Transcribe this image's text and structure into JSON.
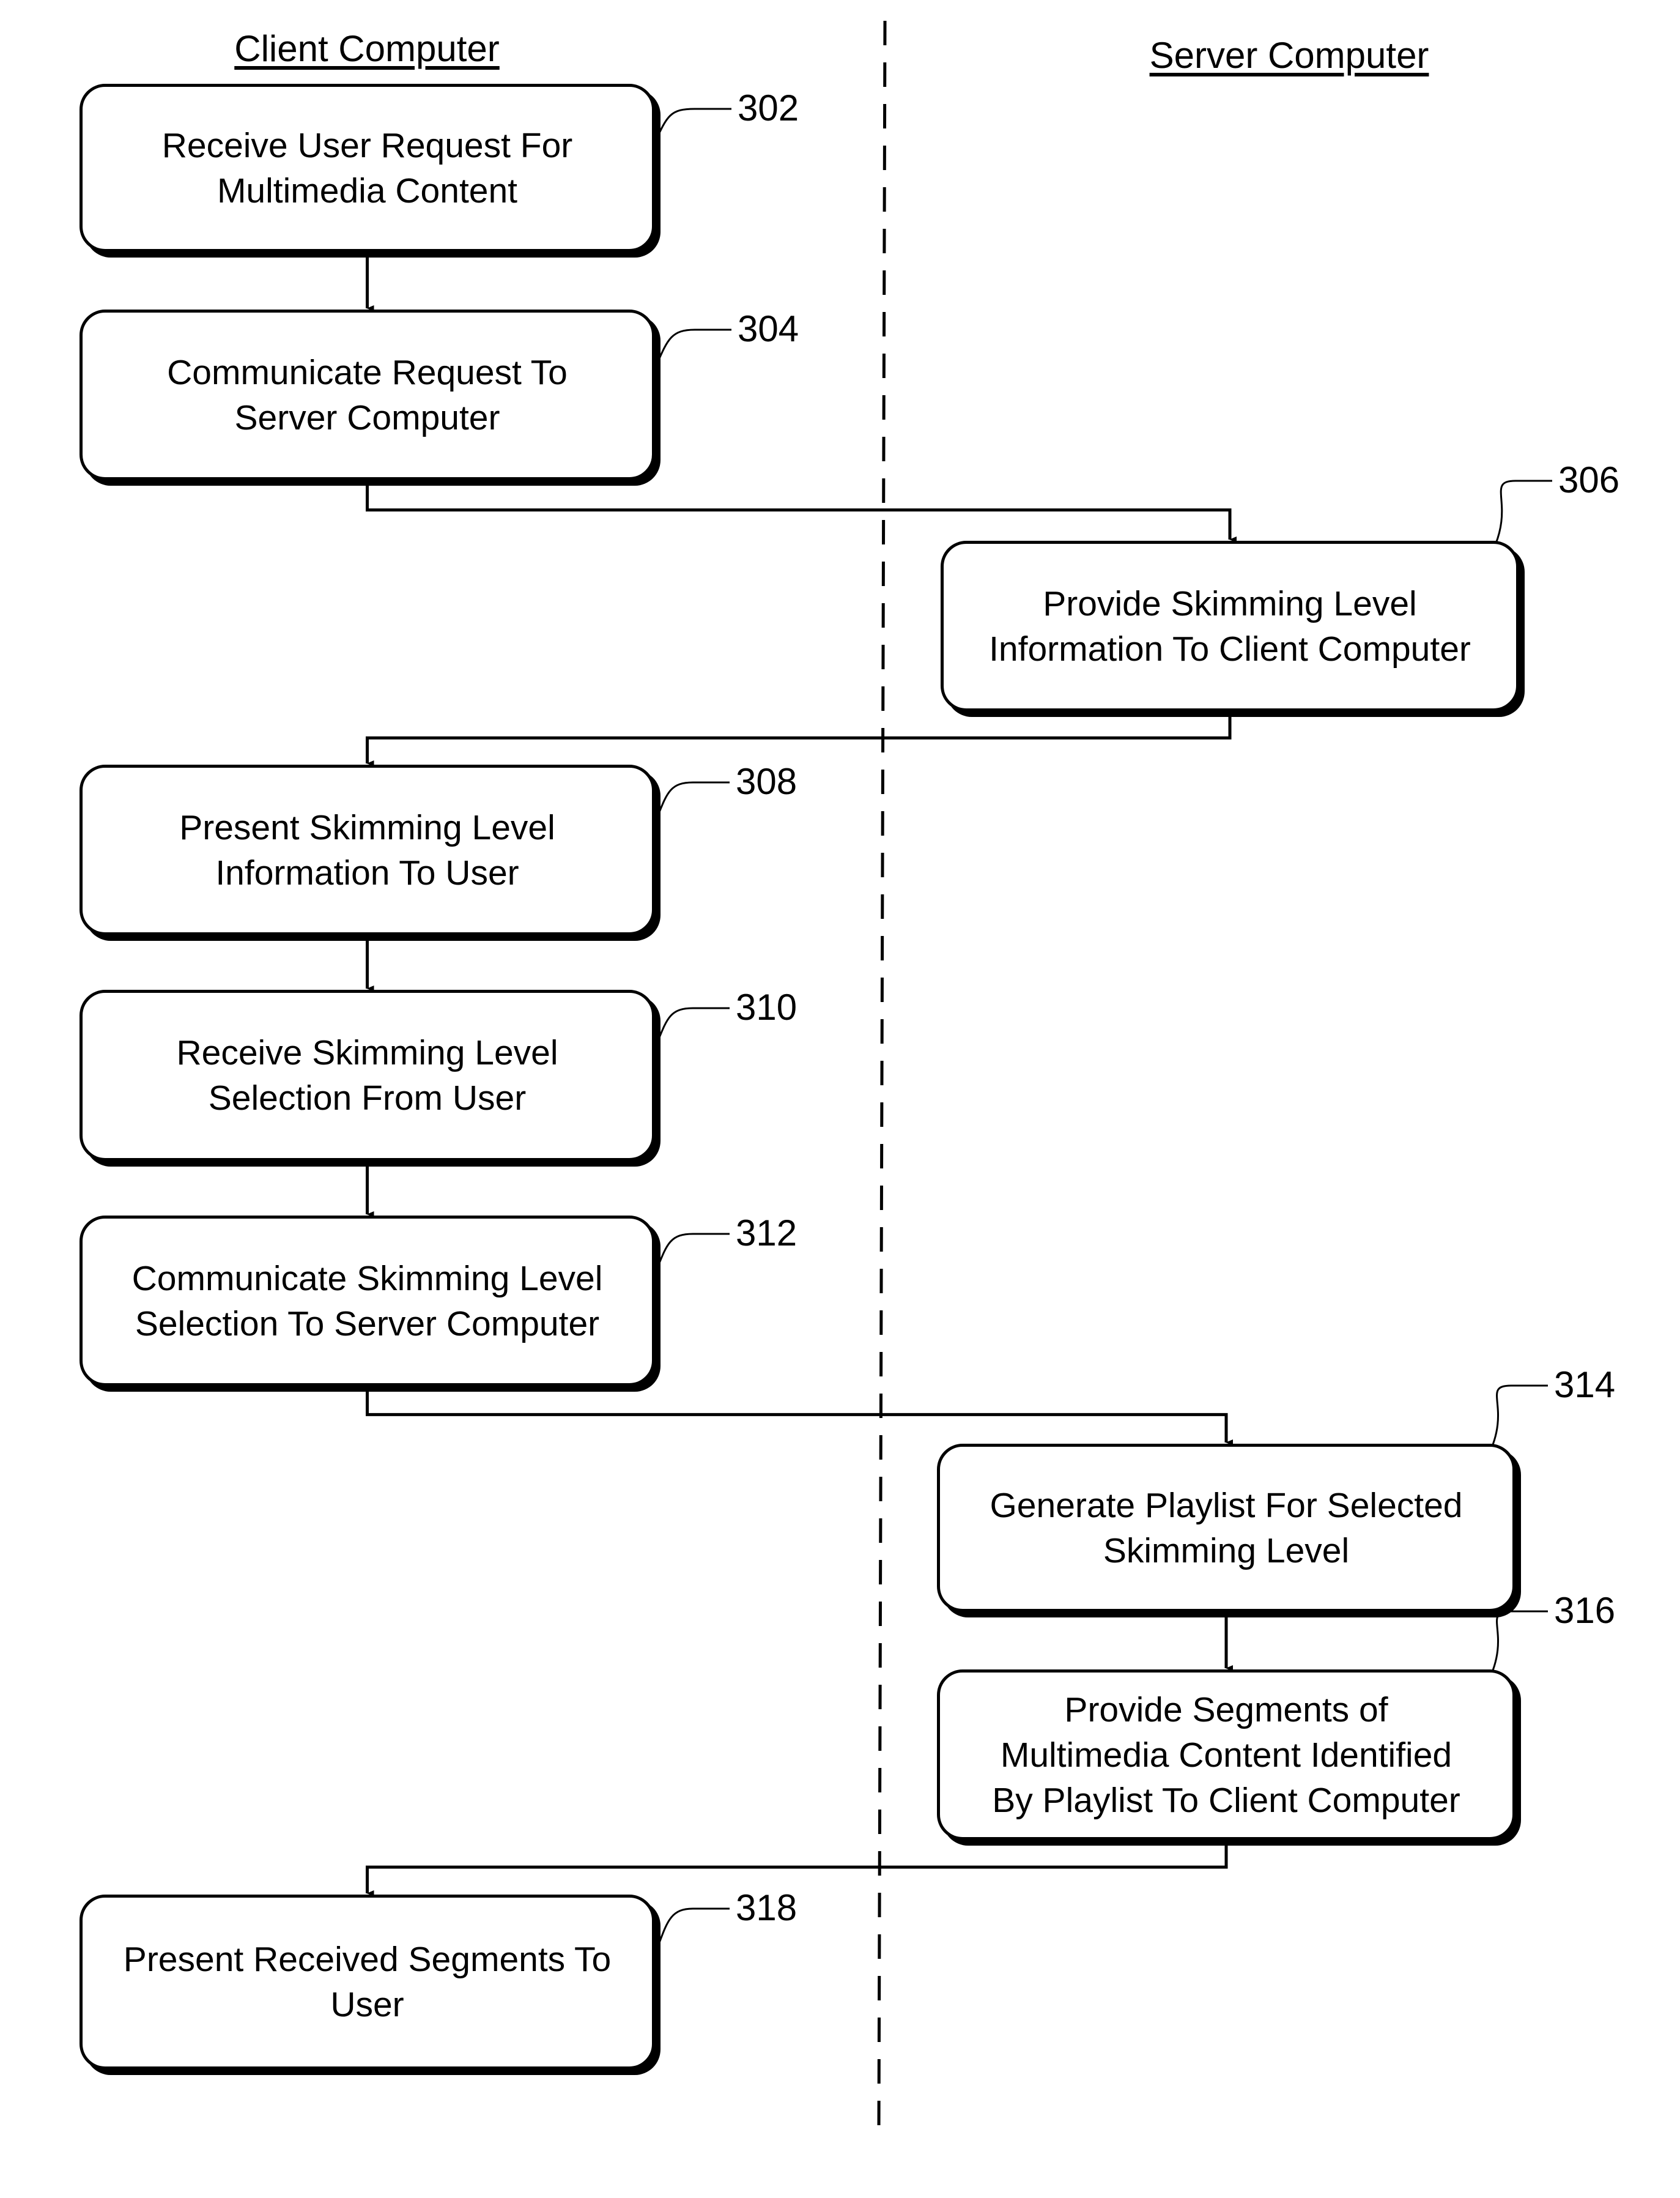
{
  "lanes": {
    "client": "Client Computer",
    "server": "Server Computer"
  },
  "steps": [
    {
      "id": "302",
      "lane": "client",
      "text": "Receive User Request For\nMultimedia Content"
    },
    {
      "id": "304",
      "lane": "client",
      "text": "Communicate Request To\nServer Computer"
    },
    {
      "id": "306",
      "lane": "server",
      "text": "Provide Skimming Level\nInformation To Client Computer"
    },
    {
      "id": "308",
      "lane": "client",
      "text": "Present Skimming Level\nInformation To User"
    },
    {
      "id": "310",
      "lane": "client",
      "text": "Receive Skimming Level\nSelection From User"
    },
    {
      "id": "312",
      "lane": "client",
      "text": "Communicate Skimming Level\nSelection To Server Computer"
    },
    {
      "id": "314",
      "lane": "server",
      "text": "Generate Playlist For Selected\nSkimming Level"
    },
    {
      "id": "316",
      "lane": "server",
      "text": "Provide Segments of\nMultimedia Content Identified\nBy Playlist To Client Computer"
    },
    {
      "id": "318",
      "lane": "client",
      "text": "Present Received Segments To\nUser"
    }
  ],
  "flow": [
    [
      "302",
      "304"
    ],
    [
      "304",
      "306"
    ],
    [
      "306",
      "308"
    ],
    [
      "308",
      "310"
    ],
    [
      "310",
      "312"
    ],
    [
      "312",
      "314"
    ],
    [
      "314",
      "316"
    ],
    [
      "316",
      "318"
    ]
  ]
}
